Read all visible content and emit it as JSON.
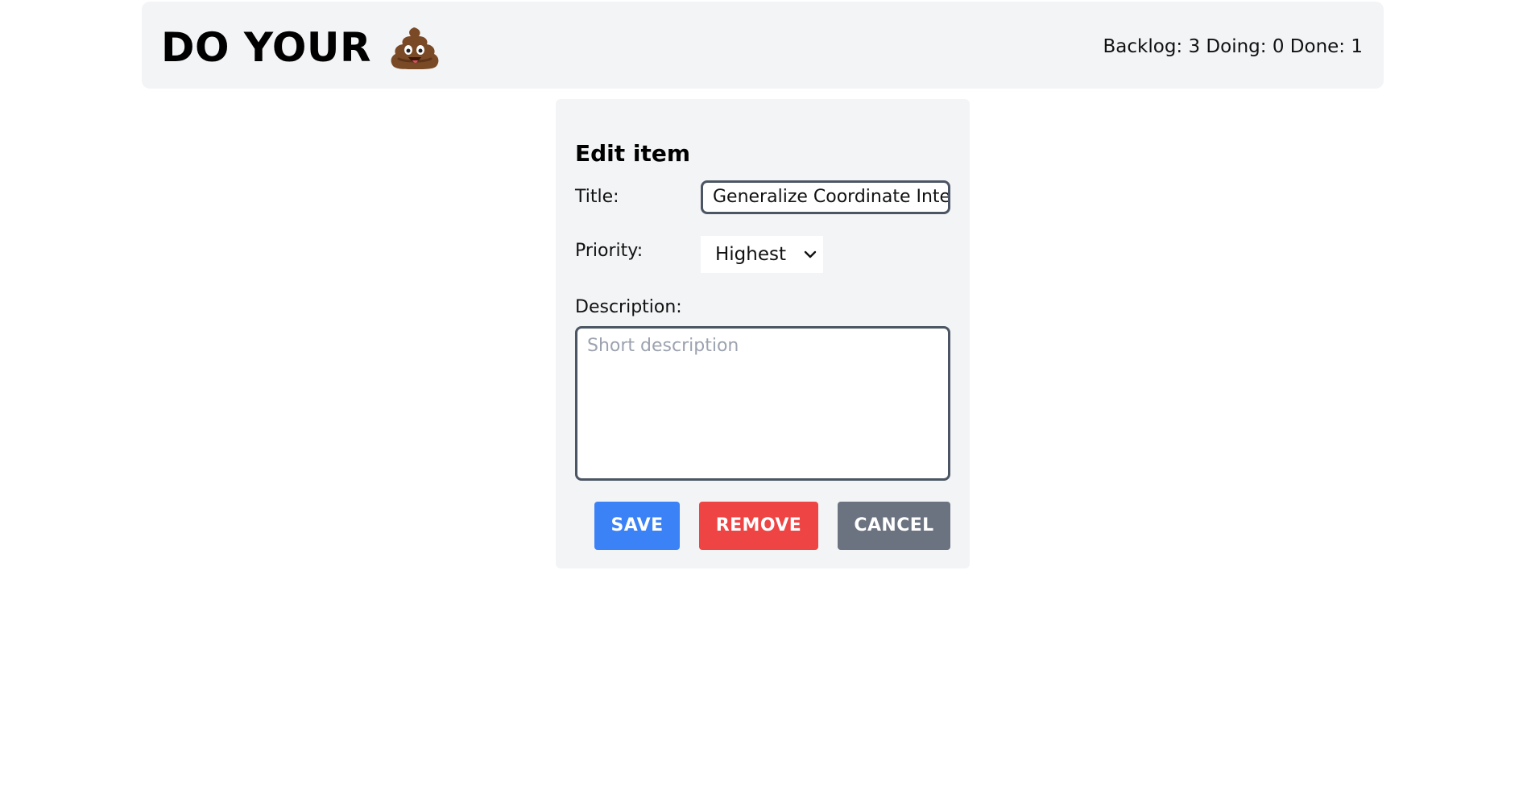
{
  "header": {
    "brand_text": "DO YOUR",
    "brand_icon": "poop-icon",
    "stats_text": "Backlog: 3 Doing: 0 Done: 1"
  },
  "dialog": {
    "title": "Edit item",
    "fields": {
      "title_label": "Title:",
      "title_value": "Generalize Coordinate Inte",
      "priority_label": "Priority:",
      "priority_value": "Highest",
      "description_label": "Description:",
      "description_placeholder": "Short description"
    },
    "buttons": {
      "save_label": "SAVE",
      "remove_label": "REMOVE",
      "cancel_label": "CANCEL"
    }
  },
  "colors": {
    "header_bg": "#f3f4f6",
    "panel_bg": "#f3f4f6",
    "save": "#3b82f6",
    "remove": "#ef4444",
    "cancel": "#6b7280",
    "input_border": "#4b5563"
  }
}
